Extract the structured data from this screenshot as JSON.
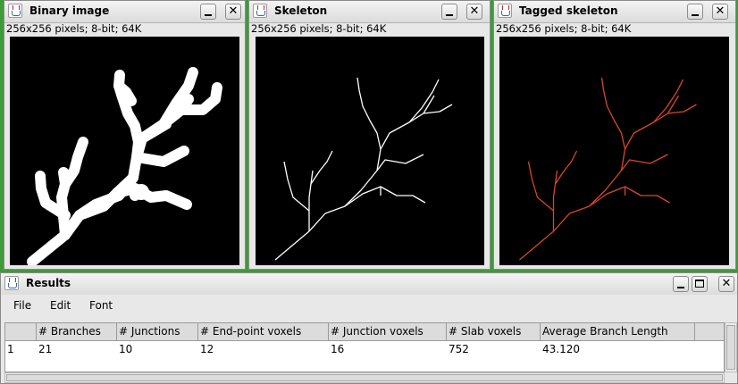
{
  "windows": [
    {
      "title": "Binary image",
      "info": "256x256 pixels; 8-bit; 64K"
    },
    {
      "title": "Skeleton",
      "info": "256x256 pixels; 8-bit; 64K"
    },
    {
      "title": "Tagged skeleton",
      "info": "256x256 pixels; 8-bit; 64K"
    }
  ],
  "results": {
    "title": "Results",
    "menu": [
      "File",
      "Edit",
      "Font"
    ],
    "columns": [
      "",
      "# Branches",
      "# Junctions",
      "# End-point voxels",
      "# Junction voxels",
      "# Slab voxels",
      "Average Branch Length"
    ],
    "row": [
      "1",
      "21",
      "10",
      "12",
      "16",
      "752",
      "43.120"
    ]
  },
  "colors": {
    "desktop": "#3f9a3a",
    "skeleton": "#ffffff",
    "tagged": "#d9462a"
  },
  "icons": [
    "java-app-icon",
    "minimize-icon",
    "maximize-icon",
    "close-icon"
  ]
}
